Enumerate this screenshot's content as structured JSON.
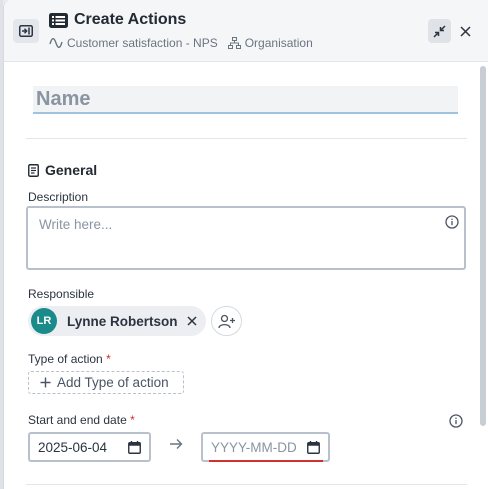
{
  "header": {
    "title": "Create Actions",
    "survey": "Customer satisfaction - NPS",
    "scope": "Organisation",
    "icons": {
      "collapse": "collapse-panel-icon",
      "title": "list-icon",
      "survey": "wave-icon",
      "scope": "hierarchy-icon",
      "minimize": "minimize-icon",
      "close": "close-icon"
    }
  },
  "form": {
    "name_placeholder": "Name",
    "section_title": "General",
    "description_label": "Description",
    "description_placeholder": "Write here...",
    "responsible_label": "Responsible",
    "responsible": {
      "initials": "LR",
      "name": "Lynne Robertson",
      "avatar_color": "#1a8a8a"
    },
    "type_label": "Type of action",
    "type_required": "*",
    "add_type_label": "Add Type of action",
    "date_label": "Start and end date",
    "date_required": "*",
    "start_date": "2025-06-04",
    "end_date_placeholder": "YYYY-MM-DD"
  },
  "colors": {
    "accent_underline": "#9fc3df",
    "required": "#d0312d",
    "avatar": "#1a8a8a"
  }
}
